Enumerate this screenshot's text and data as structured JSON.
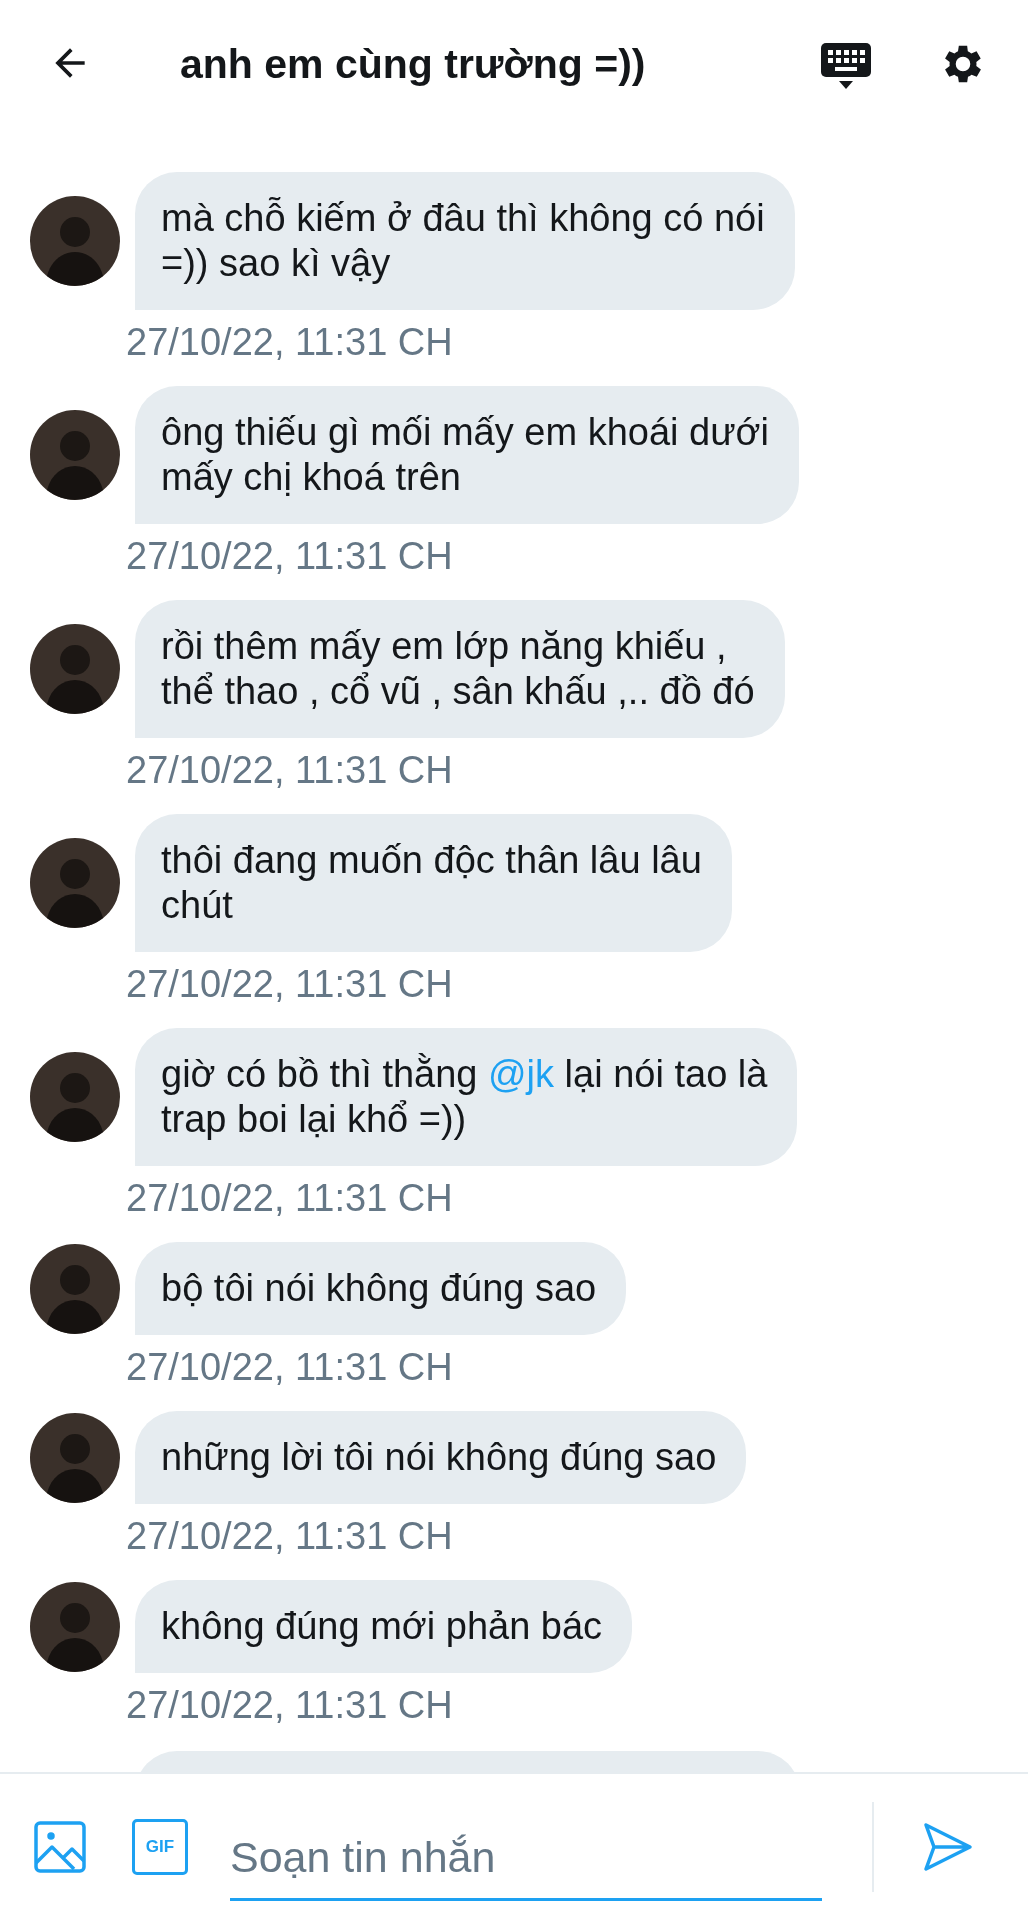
{
  "header": {
    "title": "anh em cùng trường =))"
  },
  "messages": [
    {
      "lines": [
        "mà chỗ kiếm ở đâu thì không có nói",
        "=)) sao kì vậy"
      ],
      "time": "27/10/22, 11:31 CH"
    },
    {
      "lines": [
        "ông thiếu gì mối mấy em khoái dưới",
        "mấy chị khoá trên"
      ],
      "time": "27/10/22, 11:31 CH"
    },
    {
      "lines": [
        "rồi thêm mấy em lớp năng khiếu ,",
        "thể thao , cổ vũ , sân khấu ,.. đồ đó"
      ],
      "time": "27/10/22, 11:31 CH"
    },
    {
      "lines": [
        "thôi đang muốn độc thân lâu lâu",
        "chút"
      ],
      "time": "27/10/22, 11:31 CH"
    },
    {
      "lines": [
        [
          {
            "text": "giờ có bồ thì thằng ",
            "kind": "plain"
          },
          {
            "text": "@jk",
            "kind": "mention"
          },
          {
            "text": " lại nói tao là",
            "kind": "plain"
          }
        ],
        "trap boi lại khổ =))"
      ],
      "time": "27/10/22, 11:31 CH"
    },
    {
      "lines": [
        "bộ tôi nói không đúng sao"
      ],
      "time": "27/10/22, 11:31 CH"
    },
    {
      "lines": [
        "những lời tôi nói không đúng sao"
      ],
      "time": "27/10/22, 11:31 CH"
    },
    {
      "lines": [
        "không đúng mới phản bác"
      ],
      "time": "27/10/22, 11:31 CH"
    }
  ],
  "composer": {
    "gif_label": "GIF",
    "placeholder": "Soạn tin nhắn"
  }
}
